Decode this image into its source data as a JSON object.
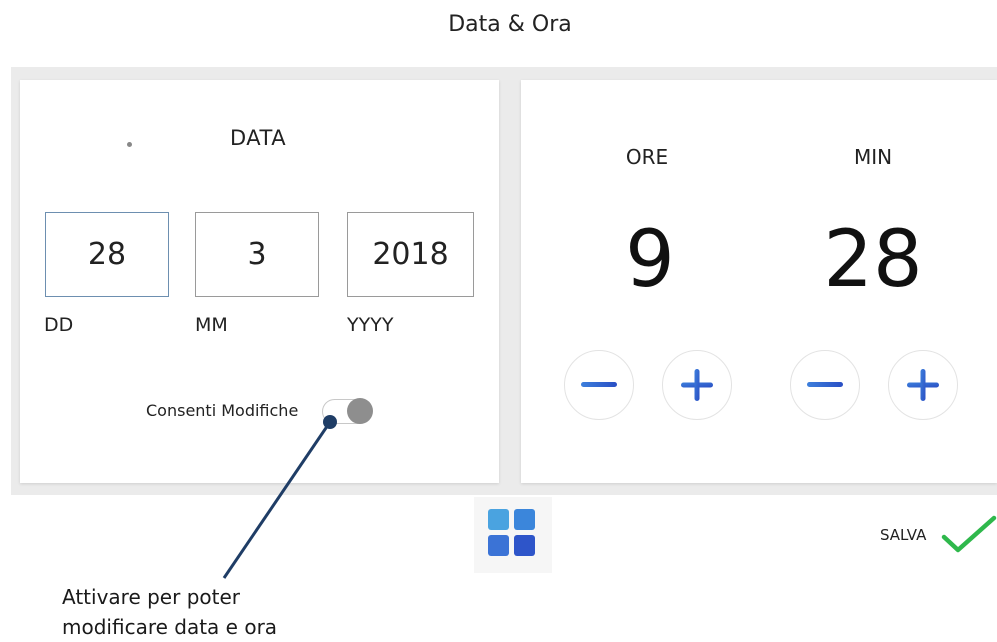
{
  "header": {
    "title": "Data & Ora"
  },
  "date_panel": {
    "heading": "DATA",
    "day": {
      "value": "28",
      "label": "DD"
    },
    "month": {
      "value": "3",
      "label": "MM"
    },
    "year": {
      "value": "2018",
      "label": "YYYY"
    },
    "toggle": {
      "label": "Consenti Modifiche",
      "state": "on"
    }
  },
  "time_panel": {
    "hours": {
      "heading": "ORE",
      "value": "9"
    },
    "minutes": {
      "heading": "MIN",
      "value": "28"
    },
    "icons": {
      "decrement": "minus-icon",
      "increment": "plus-icon"
    }
  },
  "footer": {
    "menu_icon": "grid-menu-icon",
    "save": {
      "label": "SALVA",
      "icon": "check-icon"
    }
  },
  "annotation": {
    "line1": "Attivare per poter",
    "line2": "modificare data e ora"
  },
  "colors": {
    "accent_blue": "#2f62d1",
    "check_green": "#2fb84c",
    "callout_line": "#1f3d66",
    "board_bg": "#ebebeb"
  }
}
